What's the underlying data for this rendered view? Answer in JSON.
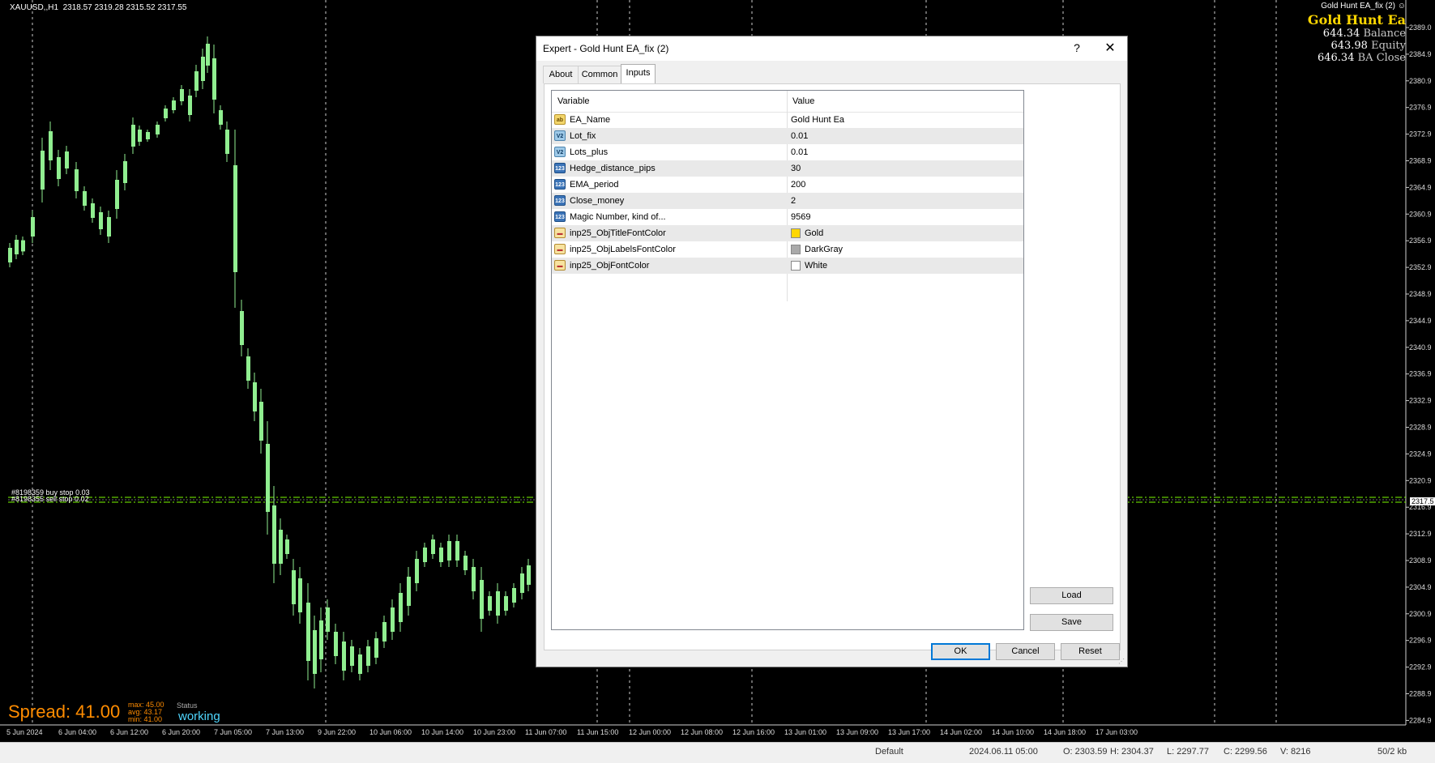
{
  "chart": {
    "symbol_header": "XAUUSD,,H1  2318.57 2319.28 2315.52 2317.55",
    "ea_name_small": "Gold Hunt EA_fix (2)",
    "ea_title": "Gold Hunt Ea",
    "balance_value": "644.34",
    "balance_label": "Balance",
    "equity_value": "643.98",
    "equity_label": "Equity",
    "ba_close_value": "646.34",
    "ba_close_label": "BA Close",
    "order_buy": "#8198359 buy stop 0.03",
    "order_sell": "#8198355 sell stop 0.02",
    "spread": "Spread: 41.00",
    "stats": [
      "max: 45.00",
      "avg: 43.17",
      "min: 41.00"
    ],
    "status_label": "Status",
    "status_value": "working",
    "current_price": "2317.5",
    "price_ticks": [
      "2389.0",
      "2384.9",
      "2380.9",
      "2376.9",
      "2372.9",
      "2368.9",
      "2364.9",
      "2360.9",
      "2356.9",
      "2352.9",
      "2348.9",
      "2344.9",
      "2340.9",
      "2336.9",
      "2332.9",
      "2328.9",
      "2324.9",
      "2320.9",
      "2316.9",
      "2312.9",
      "2308.9",
      "2304.9",
      "2300.9",
      "2296.9",
      "2292.9",
      "2288.9",
      "2284.9"
    ],
    "time_ticks": [
      "5 Jun 2024",
      "6 Jun 04:00",
      "6 Jun 12:00",
      "6 Jun 20:00",
      "7 Jun 05:00",
      "7 Jun 13:00",
      "9 Jun 22:00",
      "10 Jun 06:00",
      "10 Jun 14:00",
      "10 Jun 23:00",
      "11 Jun 07:00",
      "11 Jun 15:00",
      "12 Jun 00:00",
      "12 Jun 08:00",
      "12 Jun 16:00",
      "13 Jun 01:00",
      "13 Jun 09:00",
      "13 Jun 17:00",
      "14 Jun 02:00",
      "14 Jun 10:00",
      "14 Jun 18:00",
      "17 Jun 03:00"
    ],
    "colors": {
      "bull": "#90EE90",
      "grid": "#ffffff",
      "title": "#FFD700",
      "spread": "#FF8C00",
      "status": "#4fd7ff"
    }
  },
  "dialog": {
    "title": "Expert - Gold Hunt EA_fix (2)",
    "help": "?",
    "close": "✕",
    "tabs": [
      "About",
      "Common",
      "Inputs"
    ],
    "active_tab": "Inputs",
    "col_variable": "Variable",
    "col_value": "Value",
    "params": [
      {
        "icon": "ab",
        "name": "EA_Name",
        "value": "Gold Hunt Ea"
      },
      {
        "icon": "V2",
        "name": "Lot_fix",
        "value": "0.01"
      },
      {
        "icon": "V2",
        "name": "Lots_plus",
        "value": "0.01"
      },
      {
        "icon": "123",
        "name": "Hedge_distance_pips",
        "value": "30"
      },
      {
        "icon": "123",
        "name": "EMA_period",
        "value": "200"
      },
      {
        "icon": "123",
        "name": "Close_money",
        "value": "2"
      },
      {
        "icon": "123",
        "name": "Magic Number, kind of...",
        "value": "9569"
      },
      {
        "icon": "color",
        "name": "inp25_ObjTitleFontColor",
        "value": "Gold",
        "swatch": "#FFD700"
      },
      {
        "icon": "color",
        "name": "inp25_ObjLabelsFontColor",
        "value": "DarkGray",
        "swatch": "#A9A9A9"
      },
      {
        "icon": "color",
        "name": "inp25_ObjFontColor",
        "value": "White",
        "swatch": "#FFFFFF"
      }
    ],
    "load": "Load",
    "save": "Save",
    "ok": "OK",
    "cancel": "Cancel",
    "reset": "Reset"
  },
  "statusbar": {
    "profile": "Default",
    "datetime": "2024.06.11 05:00",
    "open": "O: 2303.59",
    "high": "H: 2304.37",
    "low": "L: 2297.77",
    "close": "C: 2299.56",
    "volume": "V: 8216",
    "traffic": "50/2 kb"
  }
}
